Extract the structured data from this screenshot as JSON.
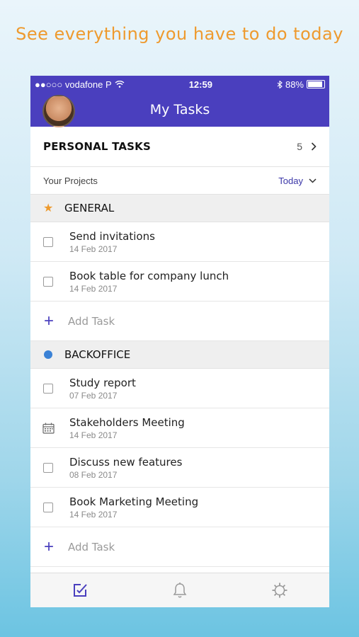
{
  "headline": "See everything you have to do today",
  "status_bar": {
    "carrier": "●●○○○ vodafone P",
    "time": "12:59",
    "battery": "88%",
    "icons": [
      "wifi-icon",
      "bluetooth-icon",
      "battery-icon"
    ]
  },
  "app_bar": {
    "title": "My Tasks"
  },
  "personal_tasks": {
    "label": "PERSONAL TASKS",
    "count": "5"
  },
  "projects": {
    "label": "Your Projects",
    "filter": "Today"
  },
  "sections": [
    {
      "name": "GENERAL",
      "icon": "star-icon",
      "color": "#ee9a2e",
      "tasks": [
        {
          "title": "Send invitations",
          "date": "14 Feb 2017",
          "icon": "checkbox"
        },
        {
          "title": "Book table for company lunch",
          "date": "14 Feb 2017",
          "icon": "checkbox"
        }
      ],
      "add_label": "Add Task"
    },
    {
      "name": "BACKOFFICE",
      "icon": "dot-icon",
      "color": "#3b82d6",
      "tasks": [
        {
          "title": "Study report",
          "date": "07 Feb 2017",
          "icon": "checkbox"
        },
        {
          "title": "Stakeholders Meeting",
          "date": "14 Feb 2017",
          "icon": "calendar-icon"
        },
        {
          "title": "Discuss new features",
          "date": "08 Feb 2017",
          "icon": "checkbox"
        },
        {
          "title": "Book Marketing Meeting",
          "date": "14 Feb 2017",
          "icon": "checkbox"
        }
      ],
      "add_label": "Add Task"
    }
  ],
  "tab_bar": {
    "tabs": [
      "tasks-icon",
      "bell-icon",
      "gear-icon"
    ],
    "active": "tasks-icon"
  },
  "colors": {
    "brand": "#4a3fbe",
    "accent": "#ee9a2e",
    "dot": "#3b82d6"
  }
}
